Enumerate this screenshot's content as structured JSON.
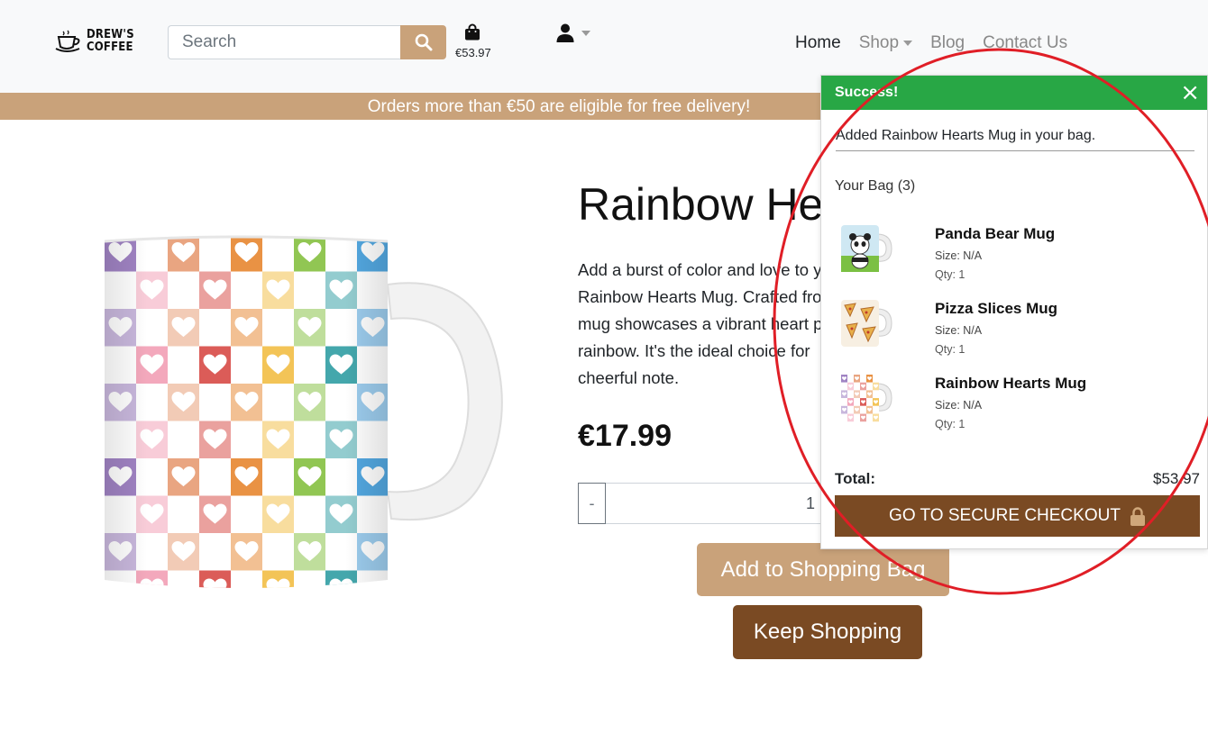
{
  "brand": {
    "line1": "DREW'S",
    "line2": "COFFEE"
  },
  "search": {
    "placeholder": "Search"
  },
  "bag": {
    "amount": "€53.97"
  },
  "nav": {
    "home": "Home",
    "shop": "Shop",
    "blog": "Blog",
    "contact": "Contact Us"
  },
  "banner": {
    "text": "Orders more than €50 are eligible for free delivery!"
  },
  "product": {
    "title": "Rainbow Hearts Mug",
    "description_lines": [
      "Add a burst of color and love to your",
      "Rainbow Hearts Mug. Crafted from",
      "mug showcases a vibrant heart pattern",
      "rainbow. It's the ideal choice for",
      "cheerful note."
    ],
    "price": "€17.99",
    "qty_minus": "-",
    "qty_value": "1",
    "add_label": "Add to Shopping Bag",
    "keep_label": "Keep Shopping"
  },
  "toast": {
    "title": "Success!",
    "close": "×",
    "message": "Added Rainbow Hearts Mug in your bag.",
    "bag_heading": "Your Bag (3)",
    "items": [
      {
        "name": "Panda Bear Mug",
        "size": "Size: N/A",
        "qty": "Qty: 1"
      },
      {
        "name": "Pizza Slices Mug",
        "size": "Size: N/A",
        "qty": "Qty: 1"
      },
      {
        "name": "Rainbow Hearts Mug",
        "size": "Size: N/A",
        "qty": "Qty: 1"
      }
    ],
    "total_label": "Total:",
    "total_value": "$53.97",
    "checkout_label": "GO TO SECURE CHECKOUT"
  },
  "colors": {
    "accent": "#c9a27a",
    "dark_brown": "#7a4a23",
    "success": "#28a745",
    "annotation": "#e01e26"
  },
  "icons": {
    "search": "search-icon",
    "bag": "shopping-bag-icon",
    "account": "user-icon",
    "lock": "lock-icon",
    "close": "close-icon"
  }
}
